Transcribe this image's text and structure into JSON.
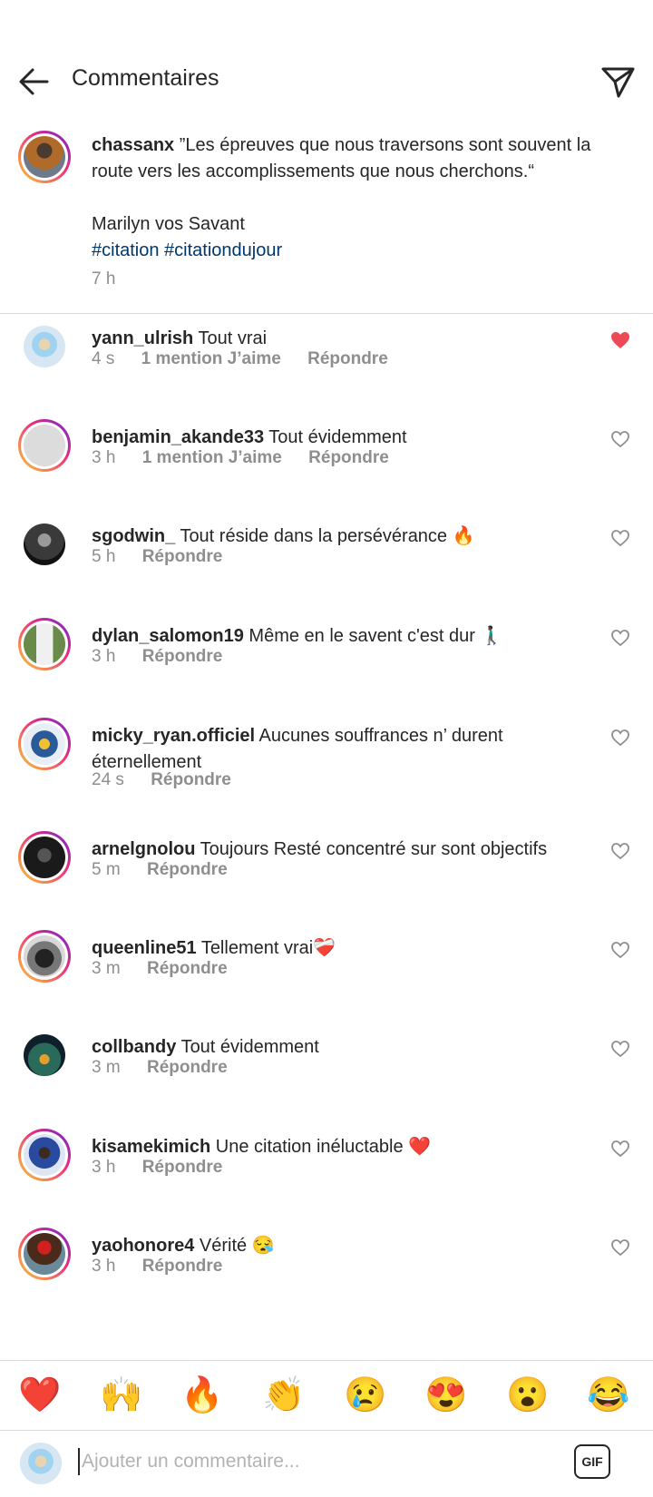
{
  "header": {
    "title": "Commentaires"
  },
  "caption": {
    "username": "chassanx",
    "text_line1": "”Les épreuves que nous traversons sont souvent la route vers les accomplissements que nous cherchons.“",
    "author": "Marilyn vos Savant",
    "hashtags": "#citation #citationdujour",
    "time": "7 h"
  },
  "comments": [
    {
      "username": "yann_ulrish",
      "text": "Tout vrai",
      "time": "4 s",
      "likes": "1 mention J’aime",
      "reply": "Répondre",
      "liked": true
    },
    {
      "username": "benjamin_akande33",
      "text": "Tout évidemment",
      "time": "3 h",
      "likes": "1 mention J’aime",
      "reply": "Répondre",
      "liked": false
    },
    {
      "username": "sgodwin_",
      "text": "Tout réside dans la persévérance 🔥",
      "time": "5 h",
      "reply": "Répondre",
      "liked": false
    },
    {
      "username": "dylan_salomon19",
      "text": "Même en le savent c'est dur 🚶🏿‍♂️",
      "time": "3 h",
      "reply": "Répondre",
      "liked": false
    },
    {
      "username": "micky_ryan.officiel",
      "text": "Aucunes souffrances n’ durent éternellement",
      "time": "24 s",
      "reply": "Répondre",
      "liked": false
    },
    {
      "username": "arnelgnolou",
      "text": "Toujours Resté concentré sur sont objectifs",
      "time": "5 m",
      "reply": "Répondre",
      "liked": false
    },
    {
      "username": "queenline51",
      "text": "Tellement vrai❤️‍🩹",
      "time": "3 m",
      "reply": "Répondre",
      "liked": false
    },
    {
      "username": "collbandy",
      "text": "Tout évidemment",
      "time": "3 m",
      "reply": "Répondre",
      "liked": false
    },
    {
      "username": "kisamekimich",
      "text": "Une citation inéluctable ❤️",
      "time": "3 h",
      "reply": "Répondre",
      "liked": false
    },
    {
      "username": "yaohonore4",
      "text": "Vérité 😪",
      "time": "3 h",
      "reply": "Répondre",
      "liked": false
    }
  ],
  "emoji_bar": [
    "❤️",
    "🙌",
    "🔥",
    "👏",
    "😢",
    "😍",
    "😮",
    "😂"
  ],
  "composer": {
    "placeholder": "Ajouter un commentaire...",
    "gif_label": "GIF"
  },
  "colors": {
    "like_red": "#ed4956",
    "hashtag_blue": "#00376b",
    "meta_gray": "#8e8e8e"
  }
}
